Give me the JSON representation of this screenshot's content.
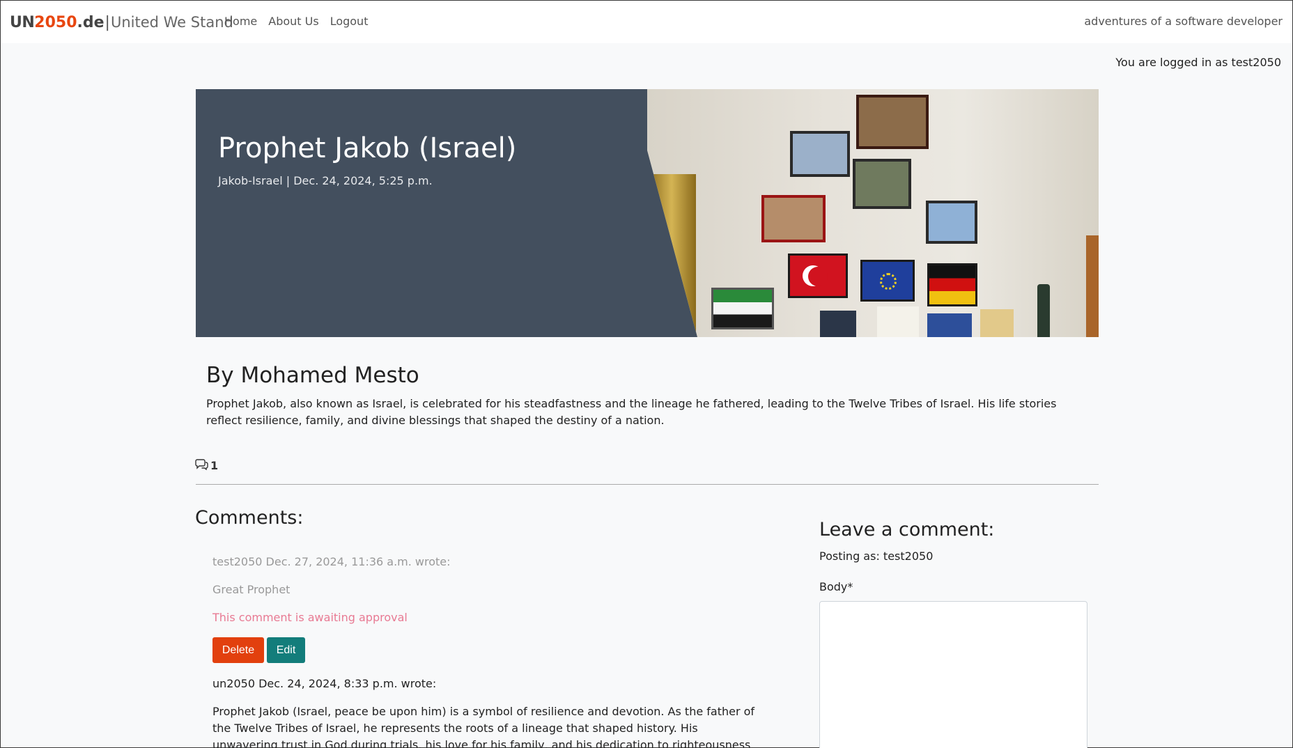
{
  "navbar": {
    "brand": {
      "un": "UN",
      "num": "2050",
      "de": ".de",
      "sep": "|",
      "tagline": "United We Stand"
    },
    "links": [
      "Home",
      "About Us",
      "Logout"
    ],
    "right_text": "adventures of a software developer"
  },
  "logged_in": "You are logged in as test2050",
  "post": {
    "title": "Prophet Jakob (Israel)",
    "meta": "Jakob-Israel | Dec. 24, 2024, 5:25 p.m.",
    "author": "By Mohamed Mesto",
    "excerpt": "Prophet Jakob, also known as Israel, is celebrated for his steadfastness and the lineage he fathered, leading to the Twelve Tribes of Israel. His life stories reflect resilience, family, and divine blessings that shaped the destiny of a nation.",
    "comment_count": "1"
  },
  "comments": {
    "title": "Comments:",
    "pending": {
      "meta": "test2050 Dec. 27, 2024, 11:36 a.m. wrote:",
      "body": "Great Prophet",
      "status": "This comment is awaiting approval",
      "delete_label": "Delete",
      "edit_label": "Edit"
    },
    "approved": {
      "meta": "un2050 Dec. 24, 2024, 8:33 p.m. wrote:",
      "body": "Prophet Jakob (Israel, peace be upon him) is a symbol of resilience and devotion. As the father of the Twelve Tribes of Israel, he represents the roots of a lineage that shaped history. His unwavering trust in God during trials, his love for his family, and his dedication to righteousness remind believers of the importance of faith."
    }
  },
  "leave_comment": {
    "title": "Leave a comment:",
    "posting_as": "Posting as: test2050",
    "body_label": "Body*",
    "body_value": ""
  },
  "colors": {
    "accent": "#e84610",
    "hero_bg": "#434f5e",
    "delete": "#e2400e",
    "edit": "#137d7b",
    "awaiting": "#e87a93"
  }
}
